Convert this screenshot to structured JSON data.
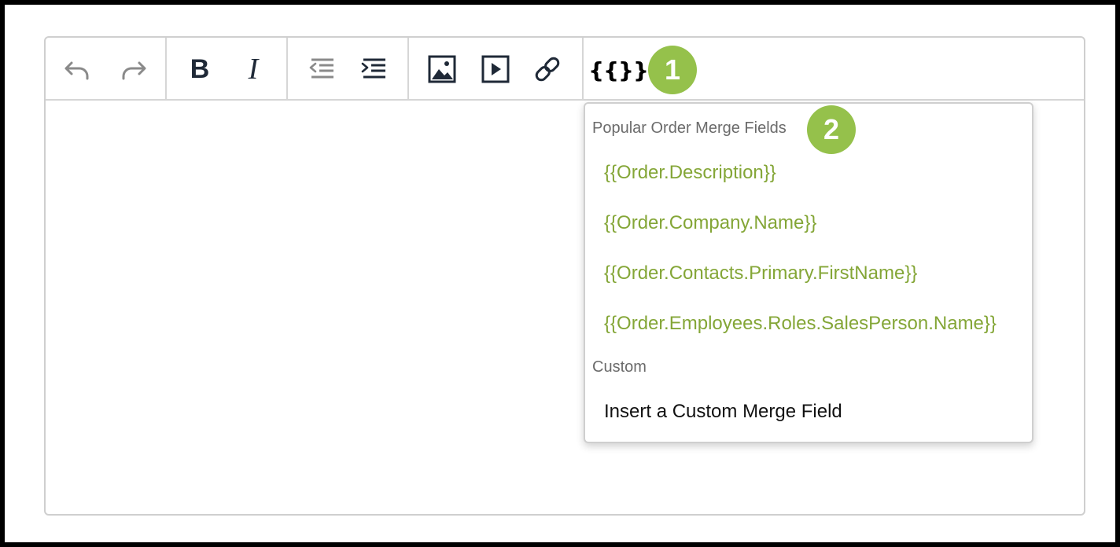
{
  "toolbar": {
    "groups": [
      {
        "name": "history",
        "buttons": [
          {
            "icon": "undo-icon"
          },
          {
            "icon": "redo-icon"
          }
        ]
      },
      {
        "name": "format",
        "buttons": [
          {
            "icon": "bold-icon",
            "glyph": "B"
          },
          {
            "icon": "italic-icon",
            "glyph": "I"
          }
        ]
      },
      {
        "name": "indent",
        "buttons": [
          {
            "icon": "outdent-icon"
          },
          {
            "icon": "indent-icon"
          }
        ]
      },
      {
        "name": "insert",
        "buttons": [
          {
            "icon": "image-icon"
          },
          {
            "icon": "video-icon"
          },
          {
            "icon": "link-icon"
          }
        ]
      }
    ],
    "merge_fields_label": "{{}}"
  },
  "badges": {
    "step1": "1",
    "step2": "2",
    "color": "#95c14b"
  },
  "dropdown": {
    "popular_title": "Popular Order Merge Fields",
    "popular_items": [
      "{{Order.Description}}",
      "{{Order.Company.Name}}",
      "{{Order.Contacts.Primary.FirstName}}",
      "{{Order.Employees.Roles.SalesPerson.Name}}"
    ],
    "custom_title": "Custom",
    "custom_item": "Insert a Custom Merge Field",
    "item_color": "#84a637"
  }
}
